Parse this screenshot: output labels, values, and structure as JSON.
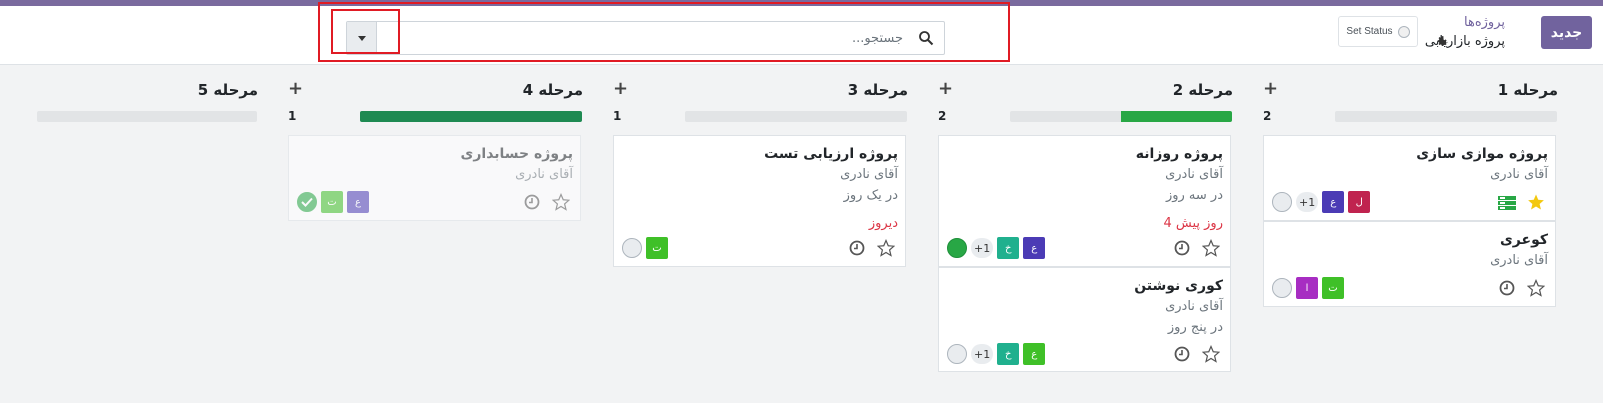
{
  "header": {
    "new_button": "جدید",
    "breadcrumb_parent": "پروژه‌ها",
    "breadcrumb_current": "پروژه بازاریابی",
    "set_status": "Set Status",
    "search_placeholder": "جستجو..."
  },
  "colors": {
    "accent": "#71639e",
    "progress_green": "#28a745",
    "progress_dark_green": "#1e8a52",
    "progress_empty": "#e2e4e6",
    "deadline_red": "#dc3545"
  },
  "columns": [
    {
      "title": "مرحله 1",
      "count": "2",
      "progress": 0,
      "cards": [
        {
          "name": "پروژه موازی سازی",
          "person": "آقای نادری",
          "starred": true,
          "icon": "dashboard-icon",
          "tags": [
            {
              "letter": "ل",
              "color": "#c0234f"
            },
            {
              "letter": "ع",
              "color": "#4b3bb5"
            }
          ],
          "more": "+1"
        },
        {
          "name": "کوعری",
          "person": "آقای نادری",
          "starred": false,
          "tags": [
            {
              "letter": "ت",
              "color": "#3fc028"
            },
            {
              "letter": "ا",
              "color": "#a72dc2"
            }
          ]
        }
      ]
    },
    {
      "title": "مرحله 2",
      "count": "2",
      "progress": 0.5,
      "cards": [
        {
          "name": "پروژه روزانه",
          "person": "آقای نادری",
          "period": "در سه روز",
          "deadline": "4 روز پیش",
          "tags": [
            {
              "letter": "ع",
              "color": "#4b3bb5"
            },
            {
              "letter": "خ",
              "color": "#20b08e"
            }
          ],
          "more": "+1",
          "status": "green"
        },
        {
          "name": "کوری نوشتن",
          "person": "آقای نادری",
          "period": "در پنج روز",
          "tags": [
            {
              "letter": "ع",
              "color": "#3fc028"
            },
            {
              "letter": "خ",
              "color": "#20b08e"
            }
          ],
          "more": "+1",
          "status": "grey"
        }
      ]
    },
    {
      "title": "مرحله 3",
      "count": "1",
      "progress": 0,
      "cards": [
        {
          "name": "پروژه ارزیابی تست",
          "person": "آقای نادری",
          "period": "در یک روز",
          "deadline": "دیروز",
          "tags": [
            {
              "letter": "ت",
              "color": "#3fc028"
            }
          ],
          "status": "grey"
        }
      ]
    },
    {
      "title": "مرحله 4",
      "count": "1",
      "progress": 1,
      "cards": [
        {
          "name": "پروژه حسابداری",
          "person": "آقای نادری",
          "tags": [
            {
              "letter": "ع",
              "color": "#4b3bb5"
            },
            {
              "letter": "ت",
              "color": "#3fc028"
            }
          ],
          "status": "check"
        }
      ]
    },
    {
      "title": "مرحله 5",
      "progress": 0,
      "cards": []
    }
  ]
}
